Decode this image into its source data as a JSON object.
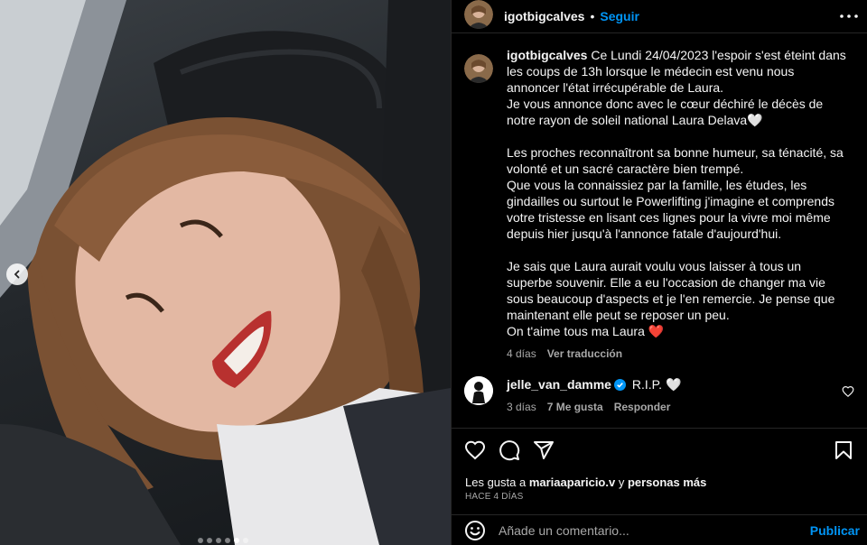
{
  "header": {
    "username": "igotbigcalves",
    "separator": "•",
    "follow_label": "Seguir",
    "more_icon": "more-horizontal-icon"
  },
  "caption": {
    "username": "igotbigcalves",
    "lines": [
      "Ce Lundi 24/04/2023 l'espoir s'est éteint dans les coups de 13h lorsque le médecin est venu nous annoncer l'état irrécupérable de Laura.",
      "Je vous annonce donc avec le cœur déchiré le décès de notre rayon de soleil national Laura Delava🤍",
      "",
      "Les proches reconnaîtront sa bonne humeur, sa ténacité, sa volonté et un sacré caractère bien trempé.",
      "Que vous la connaissiez par la famille, les études, les gindailles ou surtout le Powerlifting j'imagine et comprends votre tristesse en lisant ces lignes pour la vivre moi même depuis hier jusqu'à l'annonce fatale d'aujourd'hui.",
      "",
      "Je sais que Laura aurait voulu vous laisser à tous un superbe souvenir. Elle a eu l'occasion de changer ma vie sous beaucoup d'aspects et je l'en remercie. Je pense que maintenant elle peut se reposer un peu.",
      "On t'aime tous ma Laura ❤️"
    ],
    "age": "4 días",
    "translation_label": "Ver traducción"
  },
  "comment": {
    "username": "jelle_van_damme",
    "text": "R.I.P. 🤍",
    "age": "3 días",
    "likes": "7 Me gusta",
    "reply_label": "Responder"
  },
  "likes_line": {
    "prefix": "Les gusta a ",
    "user": "mariaaparicio.v",
    "middle": " y ",
    "others": "personas más"
  },
  "timestamp": "HACE 4 DÍAS",
  "add_comment": {
    "placeholder": "Añade un comentario...",
    "post_label": "Publicar"
  },
  "carousel": {
    "slide_count": 6,
    "active_index": 4
  },
  "colors": {
    "accent": "#0095f6",
    "background": "#000000",
    "secondary_text": "#a8a8a8"
  }
}
